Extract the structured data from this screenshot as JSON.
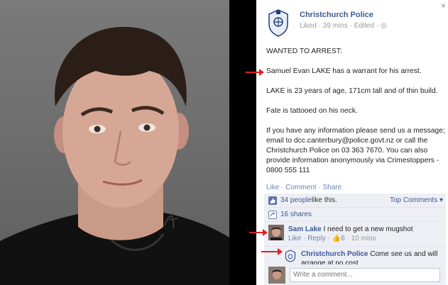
{
  "page": {
    "name": "Christchurch Police",
    "meta": "Liked · 39 mins · Edited · ",
    "close_label": "×"
  },
  "post": {
    "line1": "WANTED TO ARREST:",
    "line2": "Samuel Evan LAKE has a warrant for his arrest.",
    "line3": "LAKE is 23 years of age, 171cm tall and of thin build.",
    "line4": "Fate is tattooed on his neck.",
    "line5": "If you have any information please send us a message; email to dcc.canterbury@police.govt.nz or call the Christchurch Police on 03 363 7670. You can also provide information anonymously via Crimestoppers - 0800 555 111"
  },
  "actions": {
    "like": "Like",
    "comment": "Comment",
    "share": "Share",
    "sep": " · "
  },
  "feedback": {
    "likes_link": "34 people",
    "likes_suffix": " like this.",
    "top_comments": "Top Comments ▾",
    "shares": "16 shares"
  },
  "comments": [
    {
      "name": "Sam Lake",
      "text": " I need to get a new mugshot",
      "like": "Like",
      "reply": "Reply",
      "likes": "6",
      "time": "· 10 mins"
    },
    {
      "name": "Christchurch Police",
      "text": " Come see us and will arrange at no cost"
    }
  ],
  "write": {
    "placeholder": "Write a comment..."
  },
  "colors": {
    "fb_blue": "#3b5998",
    "arrow_red": "#e02020",
    "panel_bg": "#edeff4"
  }
}
